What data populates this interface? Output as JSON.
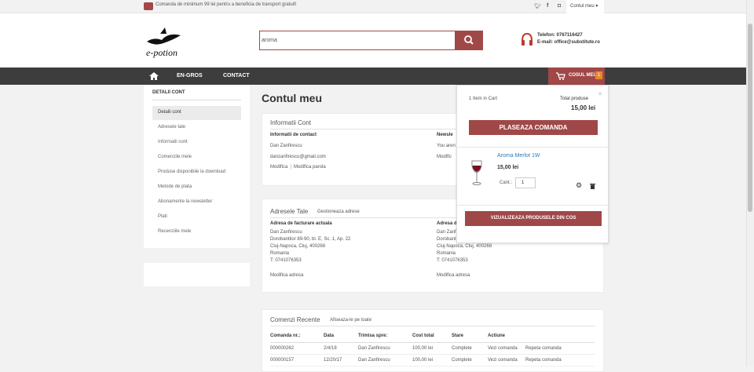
{
  "topbar": {
    "promo": "Comanda de minimum 99 lei pentru a beneficia de transport gratuit!",
    "social": [
      "twitter-icon",
      "facebook-icon",
      "instagram-icon"
    ],
    "account": "Contul meu"
  },
  "header": {
    "logo_text": "e-potion",
    "search_value": "aroma",
    "phone": "Telefon: 0767116427",
    "email": "E-mail: office@substitute.ro"
  },
  "nav": {
    "items": [
      "EN-GROS",
      "CONTACT"
    ],
    "cart_label": "COSUL MEU",
    "cart_count": "1"
  },
  "sidebar": {
    "title": "DETALII CONT",
    "items": [
      "Detalii cont",
      "Adresele tale",
      "Informatii cont",
      "Comenzile mele",
      "Produse disponibile la download",
      "Metode de plata",
      "Abonamente la newsletter",
      "Plati",
      "Recenziile mele"
    ]
  },
  "main": {
    "title": "Contul meu",
    "info": {
      "title": "Informatii Cont",
      "contact_heading": "Informatii de contact",
      "name": "Dan Zanfirescu",
      "email": "danzanfirescu@gmail.com",
      "edit": "Modifica",
      "change_pw": "Modifica parola",
      "news_heading": "Newsle",
      "news_text": "You aren",
      "news_edit": "Modific"
    },
    "addresses": {
      "title": "Adresele Tale",
      "manage": "Gestioneaza adrese",
      "billing_heading": "Adresa de facturare actuala",
      "billing_lines": [
        "Dan Zanfirescu",
        "Dorobantilor 89-90, bl. E, Sc. 1, Ap. 22",
        "Cluj-Napoca, Cluj, 400268",
        "Romania",
        "T: 0741076353"
      ],
      "billing_edit": "Modifica adresa",
      "shipping_heading": "Adresa d",
      "shipping_lines": [
        "Dan Zanfirescu",
        "Dorobantilor 89-90, bl. E, Sc. 1, Ap. 22",
        "Cluj-Napoca, Cluj, 400268",
        "Romania",
        "T: 0741076353"
      ],
      "shipping_edit": "Modifica adresa"
    },
    "orders": {
      "title": "Comenzi Recente",
      "view_all": "Afiseaza-le pe toate",
      "headers": [
        "Comanda nr.:",
        "Data",
        "Trimisa spre:",
        "Cost total",
        "Stare",
        "Actiune"
      ],
      "rows": [
        [
          "000000262",
          "2/4/18",
          "Dan Zanfirescu",
          "100,00 lei",
          "Complete",
          "Vezi comanda",
          "Repeta comanda"
        ],
        [
          "000000157",
          "12/20/17",
          "Dan Zanfirescu",
          "100,00 lei",
          "Complete",
          "Vezi comanda",
          "Repeta comanda"
        ]
      ]
    }
  },
  "cart": {
    "items_label": "1 Item in Cart",
    "total_label": "Total produse",
    "total": "15,00 lei",
    "checkout": "PLASEAZA COMANDA",
    "product_name": "Aroma Merlot 1W",
    "product_price": "15,00 lei",
    "qty_label": "Cant.:",
    "qty": "1",
    "view_cart": "VIZUALIZEAZA PRODUSELE DIN COS"
  },
  "colors": {
    "accent": "#a04848",
    "nav": "#3d3d3d",
    "link": "#2a7ab8"
  }
}
